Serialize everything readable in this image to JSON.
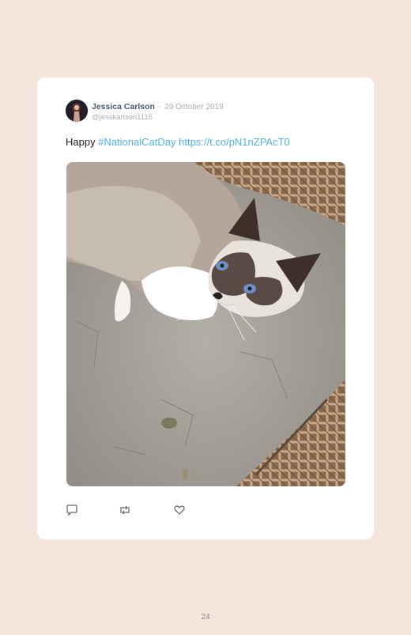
{
  "tweet": {
    "author_name": "Jessica Carlson",
    "separator": "·",
    "date": "29 October 2019",
    "handle": "@jesskarlson1115",
    "text_prefix": "Happy ",
    "hashtag": "#NationalCatDay",
    "link": "https://t.co/pN1nZPAcT0",
    "photo_subject": "siamese-cat-photo"
  },
  "actions": {
    "reply_icon": "reply-icon",
    "retweet_icon": "retweet-icon",
    "like_icon": "heart-icon"
  },
  "colors": {
    "background": "#f5e6dd",
    "card": "#ffffff",
    "link": "#4fb0e8",
    "name": "#4a5a6c",
    "muted": "#a8aeb6"
  },
  "page": {
    "number": "24"
  }
}
